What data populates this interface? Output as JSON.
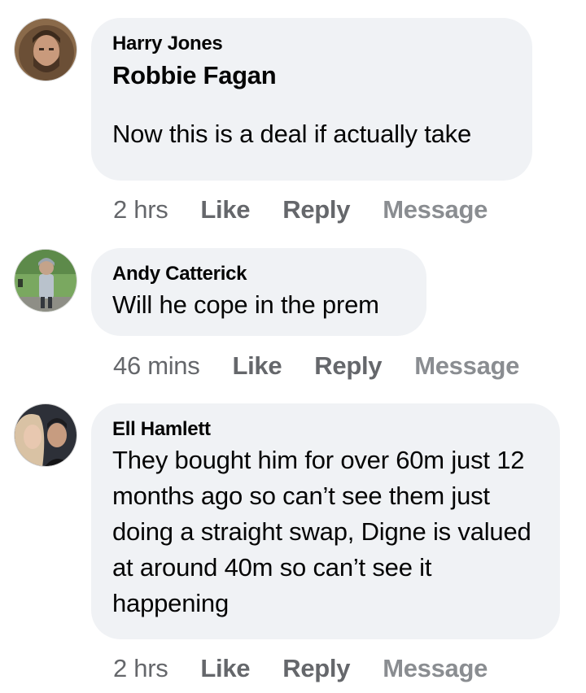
{
  "comments": [
    {
      "author": "Harry Jones",
      "mention": "Robbie Fagan",
      "text": "Now this is a deal if actually take",
      "time": "2 hrs",
      "like_label": "Like",
      "reply_label": "Reply",
      "message_label": "Message",
      "avatar_icon": "user-avatar-hooded-man"
    },
    {
      "author": "Andy Catterick",
      "text": "Will he cope in the prem",
      "time": "46 mins",
      "like_label": "Like",
      "reply_label": "Reply",
      "message_label": "Message",
      "avatar_icon": "user-avatar-child-outdoors"
    },
    {
      "author": "Ell Hamlett",
      "text": "They bought him for over 60m just 12 months ago so can’t see them just doing a straight swap, Digne is valued at around 40m so can’t see it happening",
      "time": "2 hrs",
      "like_label": "Like",
      "reply_label": "Reply",
      "message_label": "Message",
      "avatar_icon": "user-avatar-couple"
    }
  ],
  "colors": {
    "bubble_bg": "#f0f2f5",
    "text": "#050505",
    "secondary_text": "#65676b",
    "message_text": "#8a8d91"
  }
}
